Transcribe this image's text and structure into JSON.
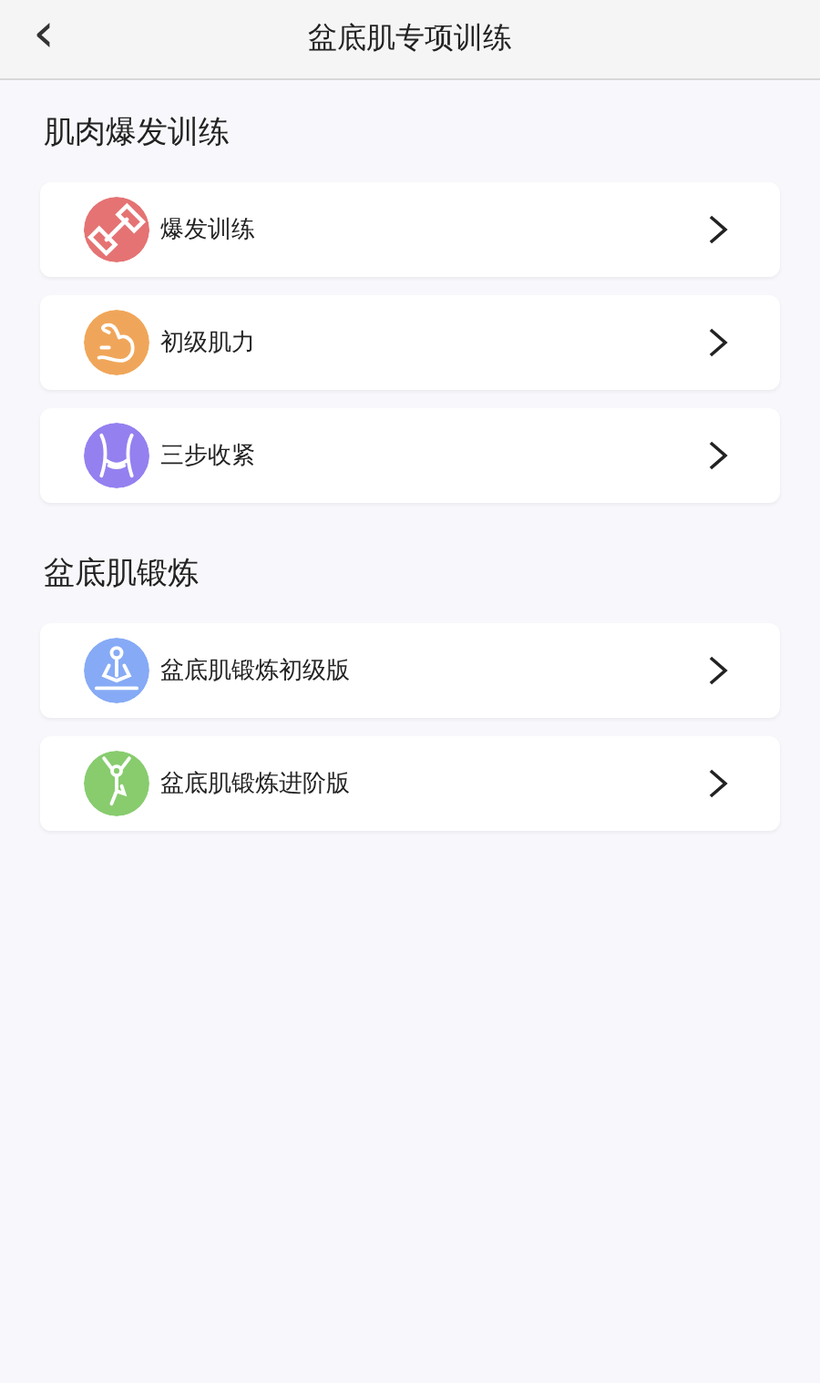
{
  "header": {
    "back": "‹",
    "title": "盆底肌专项训练"
  },
  "sections": [
    {
      "title": "肌肉爆发训练",
      "items": [
        {
          "label": "爆发训练",
          "kind": "dumbbell",
          "color": "#e57373"
        },
        {
          "label": "初级肌力",
          "kind": "arm",
          "color": "#f0a65a"
        },
        {
          "label": "三步收紧",
          "kind": "waist",
          "color": "#9580f0"
        }
      ]
    },
    {
      "title": "盆底肌锻炼",
      "items": [
        {
          "label": "盆底肌锻炼初级版",
          "kind": "meditate",
          "color": "#86aaf5"
        },
        {
          "label": "盆底肌锻炼进阶版",
          "kind": "yoga",
          "color": "#88cc6e"
        }
      ]
    }
  ]
}
